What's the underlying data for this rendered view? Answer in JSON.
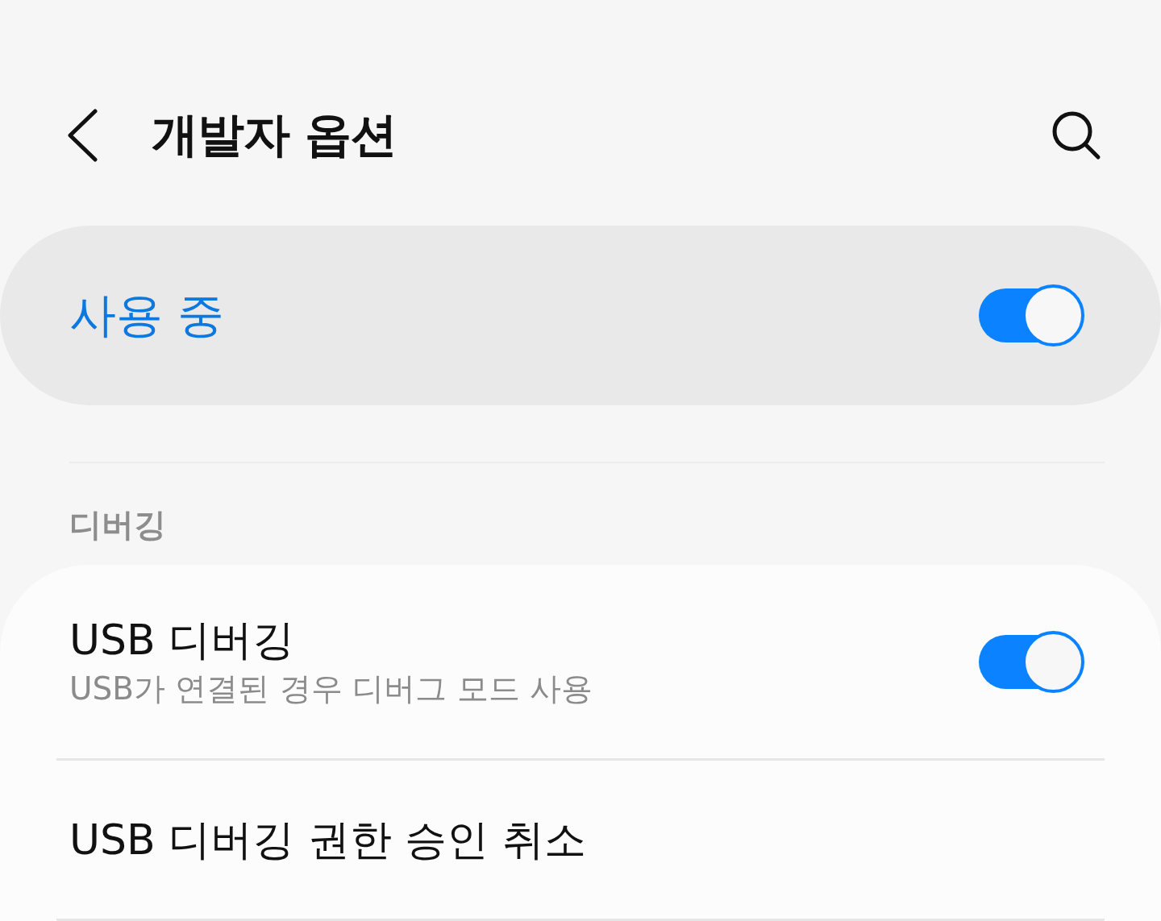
{
  "header": {
    "title": "개발자 옵션"
  },
  "master_switch": {
    "label": "사용 중",
    "on": true
  },
  "sections": [
    {
      "title": "디버깅",
      "items": [
        {
          "kind": "toggle",
          "title": "USB 디버깅",
          "subtitle": "USB가 연결된 경우 디버그 모드 사용",
          "on": true
        },
        {
          "kind": "action",
          "title": "USB 디버깅 권한 승인 취소"
        }
      ]
    }
  ]
}
